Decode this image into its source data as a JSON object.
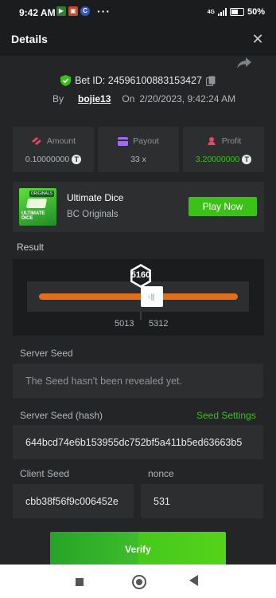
{
  "status_bar": {
    "time": "9:42 AM",
    "more": "···",
    "network": "4G",
    "battery": "50%"
  },
  "header": {
    "title": "Details",
    "close_symbol": "✕"
  },
  "bet": {
    "id_label": "Bet ID: 24596100883153427",
    "by_label": "By",
    "user": "bojie13",
    "on_label": "On",
    "datetime": "2/20/2023, 9:42:24 AM"
  },
  "stats": {
    "amount": {
      "label": "Amount",
      "value": "0.10000000"
    },
    "payout": {
      "label": "Payout",
      "value": "33 x"
    },
    "profit": {
      "label": "Profit",
      "value": "3.20000000"
    }
  },
  "game": {
    "name": "Ultimate Dice",
    "provider": "BC Originals",
    "thumb_text_line1": "ULTIMATE",
    "thumb_text_line2": "DICE",
    "thumb_badge": "ORIGINALS",
    "play_label": "Play Now"
  },
  "result": {
    "label": "Result",
    "value": "5160",
    "range_low": "5013",
    "range_high": "5312",
    "slider_level": 0.52
  },
  "server_seed": {
    "label": "Server Seed",
    "value": "The Seed hasn't been revealed yet."
  },
  "server_seed_hash": {
    "label": "Server Seed (hash)",
    "settings_link": "Seed Settings",
    "value": "644bcd74e6b153955dc752bf5a411b5ed63663b5"
  },
  "client_seed": {
    "label": "Client Seed",
    "value": "cbb38f56f9c006452e"
  },
  "nonce": {
    "label": "nonce",
    "value": "531"
  },
  "verify_label": "Verify",
  "colors": {
    "accent": "#3bc117",
    "range_bar": "#e26e1a",
    "background": "#232527",
    "card": "#2c2e30"
  }
}
